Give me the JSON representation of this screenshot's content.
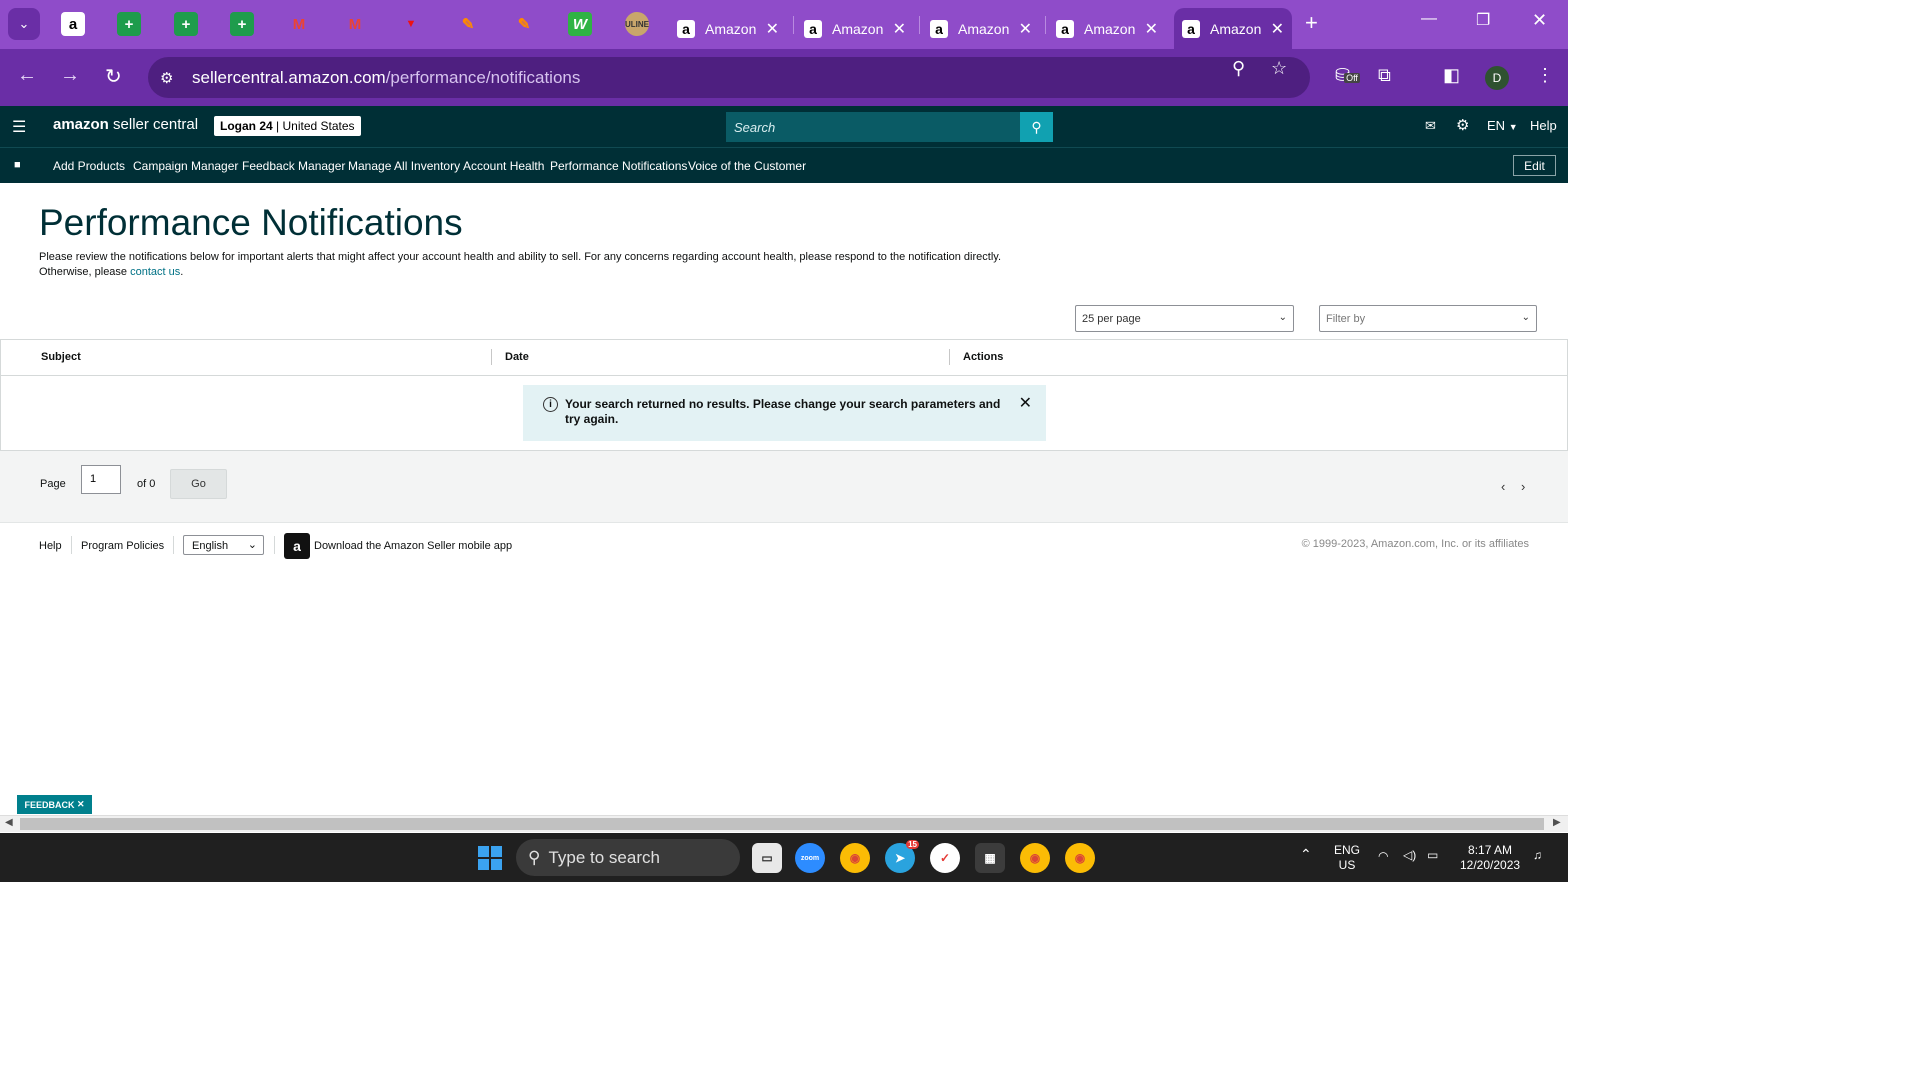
{
  "browser": {
    "pinned_tabs": [
      "amazon-icon",
      "sheets-icon",
      "sheets-icon",
      "sheets-icon",
      "gmail-icon",
      "gmail-icon",
      "app-icon",
      "tasks-icon",
      "tasks-icon",
      "wise-icon",
      "uline-icon"
    ],
    "tabs": [
      {
        "title": "Amazon"
      },
      {
        "title": "Amazon"
      },
      {
        "title": "Amazon"
      },
      {
        "title": "Amazon"
      },
      {
        "title": "Amazon"
      }
    ],
    "url_host": "sellercentral.amazon.com",
    "url_path": "/performance/notifications",
    "ext_badge": "Off",
    "profile_initial": "D"
  },
  "seller": {
    "logo_amazon": "amazon",
    "logo_rest": "seller central",
    "account_name": "Logan 24",
    "account_region": "| United States",
    "search_placeholder": "Search",
    "lang": "EN",
    "help": "Help"
  },
  "nav": {
    "links": [
      "Add Products",
      "Campaign Manager",
      "Feedback Manager",
      "Manage All Inventory",
      "Account Health",
      "Performance Notifications",
      "Voice of the Customer"
    ],
    "edit": "Edit"
  },
  "page": {
    "title": "Performance Notifications",
    "intro": "Please review the notifications below for important alerts that might affect your account health and ability to sell. For any concerns regarding account health, please respond to the notification directly. Otherwise, please ",
    "contact_link": "contact us",
    "per_page": "25 per page",
    "filter_placeholder": "Filter by"
  },
  "table": {
    "columns": [
      "Subject",
      "Date",
      "Actions"
    ],
    "alert": "Your search returned no results. Please change your search parameters and try again."
  },
  "pager": {
    "page_label": "Page",
    "page_value": "1",
    "of_label": "of 0",
    "go": "Go"
  },
  "footer": {
    "help": "Help",
    "policies": "Program Policies",
    "language": "English",
    "app": "Download the Amazon Seller mobile app",
    "copyright": "© 1999-2023, Amazon.com, Inc. or its affiliates"
  },
  "feedback": "FEEDBACK",
  "taskbar": {
    "search": "Type to search",
    "lang_top": "ENG",
    "lang_bottom": "US",
    "time": "8:17 AM",
    "date": "12/20/2023",
    "telegram_badge": "15"
  }
}
